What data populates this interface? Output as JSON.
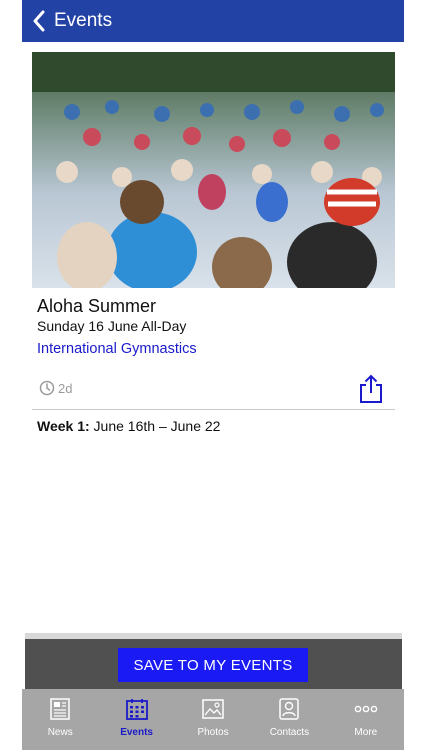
{
  "header": {
    "title": "Events",
    "back_icon": "chevron-left-icon"
  },
  "event": {
    "title": "Aloha Summer",
    "date": "Sunday 16 June All-Day",
    "organizer": "International Gymnastics",
    "age": "2d",
    "week_label": "Week 1:",
    "week_range": " June 16th – June 22"
  },
  "actions": {
    "save_label": "SAVE TO MY EVENTS"
  },
  "tabs": [
    {
      "label": "News",
      "icon": "newspaper-icon",
      "active": false
    },
    {
      "label": "Events",
      "icon": "calendar-icon",
      "active": true
    },
    {
      "label": "Photos",
      "icon": "photo-icon",
      "active": false
    },
    {
      "label": "Contacts",
      "icon": "contact-card-icon",
      "active": false
    },
    {
      "label": "More",
      "icon": "more-dots-icon",
      "active": false
    }
  ],
  "colors": {
    "header_bg": "#2242a6",
    "accent_blue": "#1a1af5",
    "link_blue": "#1a1acc",
    "tabbar_bg": "#a6a6a6",
    "save_bar_bg": "#505050"
  }
}
